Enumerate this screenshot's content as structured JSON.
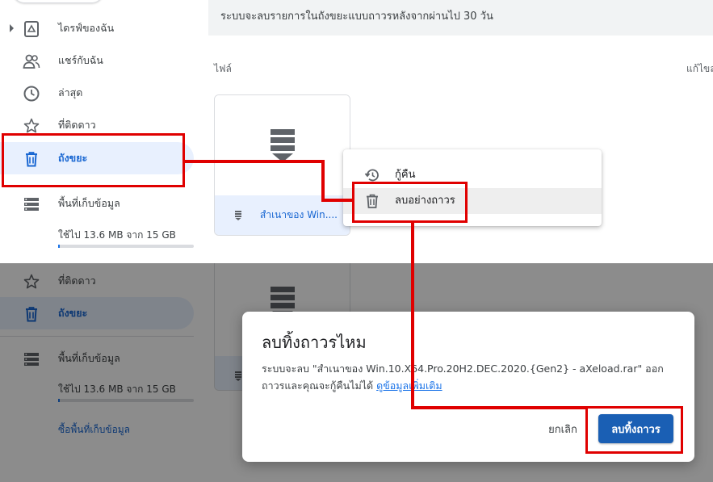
{
  "banner": {
    "text": "ระบบจะลบรายการในถังขยะแบบถาวรหลังจากผ่านไป 30 วัน"
  },
  "content": {
    "files_label": "ไฟล์",
    "modified_label": "แก้ไขล่"
  },
  "sidebar": {
    "items": [
      {
        "label": "ไดรฟ์ของฉัน",
        "icon": "my-drive-icon"
      },
      {
        "label": "แชร์กับฉัน",
        "icon": "shared-icon"
      },
      {
        "label": "ล่าสุด",
        "icon": "recent-clock-icon"
      },
      {
        "label": "ที่ติดดาว",
        "icon": "star-icon"
      },
      {
        "label": "ถังขยะ",
        "icon": "trash-icon"
      }
    ],
    "storage": {
      "label": "พื้นที่เก็บข้อมูล",
      "usage": "ใช้ไป 13.6 MB จาก 15 GB",
      "used_fraction": 0.001
    },
    "buy_storage": "ซื้อพื้นที่เก็บข้อมูล"
  },
  "file": {
    "name": "สำเนาของ Win...."
  },
  "context_menu": {
    "restore": "กู้คืน",
    "delete_forever": "ลบอย่างถาวร"
  },
  "dialog": {
    "title": "ลบทิ้งถาวรไหม",
    "message": "ระบบจะลบ \"สำเนาของ Win.10.X64.Pro.20H2.DEC.2020.{Gen2} - aXeload.rar\" ออกถาวรและคุณจะกู้คืนไม่ได้",
    "learn_more": "ดูข้อมูลเพิ่มเติม",
    "cancel": "ยกเลิก",
    "confirm": "ลบทิ้งถาวร"
  },
  "colors": {
    "accent": "#1a73e8",
    "highlight": "#e00000"
  }
}
